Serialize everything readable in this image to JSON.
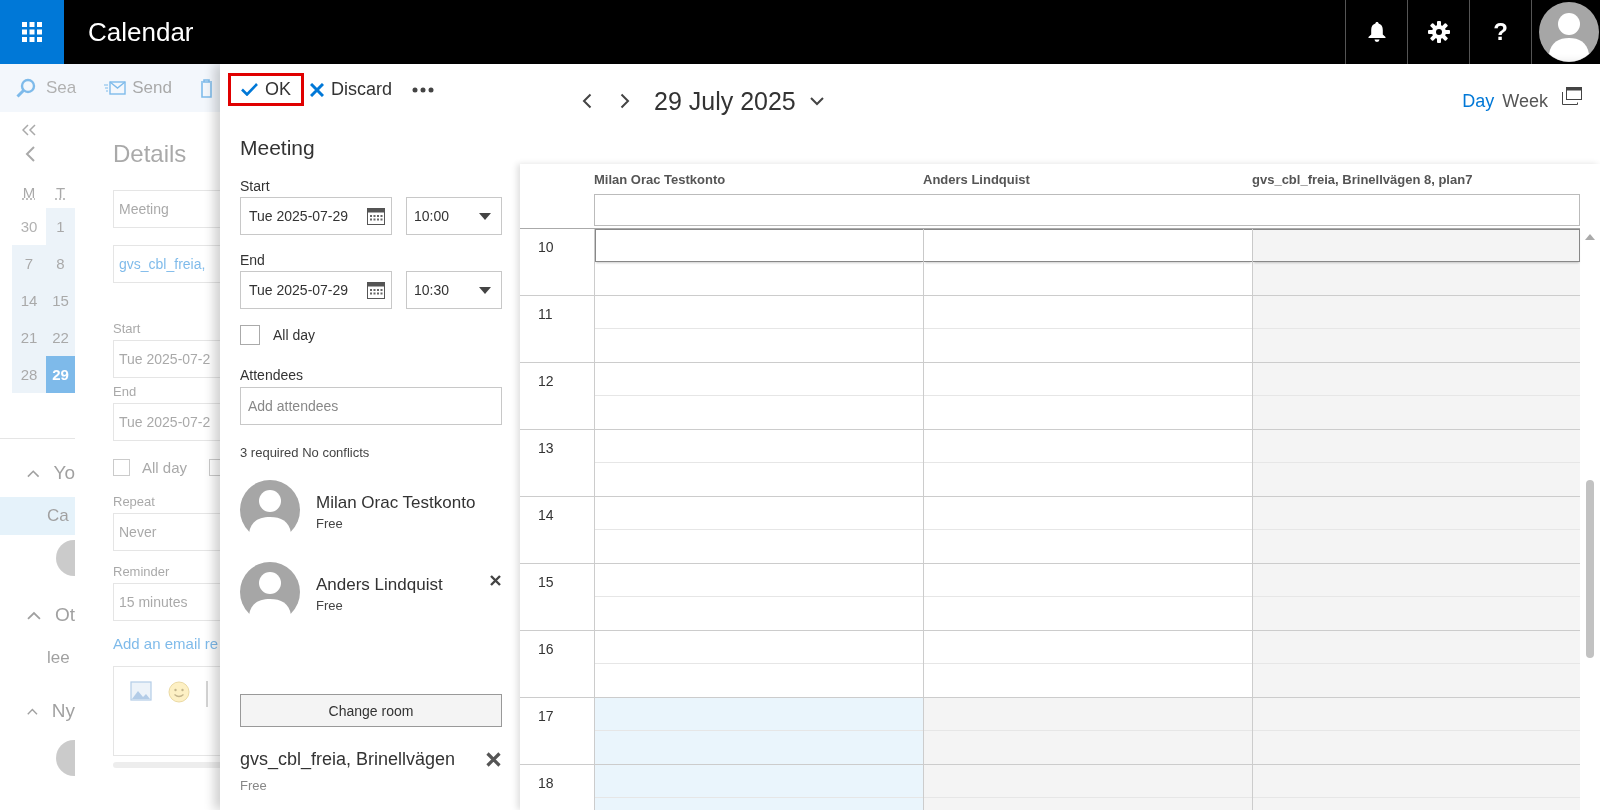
{
  "app_bar": {
    "title": "Calendar",
    "help": "?"
  },
  "background": {
    "search": "Sea",
    "send": "Send",
    "mini_calendar": {
      "weekdays": [
        "M",
        "T"
      ],
      "days": [
        {
          "label": "30",
          "selected": false,
          "outside_month": true
        },
        {
          "label": "1",
          "selected": false,
          "outside_month": false
        },
        {
          "label": "7",
          "selected": false,
          "outside_month": false
        },
        {
          "label": "8",
          "selected": false,
          "outside_month": false
        },
        {
          "label": "14",
          "selected": false,
          "outside_month": false
        },
        {
          "label": "15",
          "selected": false,
          "outside_month": false
        },
        {
          "label": "21",
          "selected": false,
          "outside_month": false
        },
        {
          "label": "22",
          "selected": false,
          "outside_month": false
        },
        {
          "label": "28",
          "selected": false,
          "outside_month": false
        },
        {
          "label": "29",
          "selected": true,
          "outside_month": false
        }
      ]
    },
    "sections": [
      {
        "title": "Yo",
        "expanded": true,
        "items": [
          {
            "kind": "text",
            "label": "Ca",
            "selected": true
          },
          {
            "kind": "person"
          }
        ]
      },
      {
        "title": "Ot",
        "expanded": true,
        "items": [
          {
            "kind": "text",
            "label": "lee",
            "selected": false
          }
        ]
      },
      {
        "title": "Ny",
        "expanded": true,
        "items": [
          {
            "kind": "person"
          }
        ]
      }
    ],
    "details": {
      "title": "Details",
      "subject": "Meeting",
      "location": "gvs_cbl_freia,",
      "start_label": "Start",
      "start": "Tue 2025-07-2",
      "end_label": "End",
      "end": "Tue 2025-07-2",
      "checkboxes": [
        {
          "label": "All day",
          "checked": false
        },
        {
          "checked": false
        }
      ],
      "repeat_label": "Repeat",
      "repeat": "Never",
      "reminder_label": "Reminder",
      "reminder": "15 minutes",
      "add_email_link": "Add an email re"
    }
  },
  "form": {
    "ok": {
      "label": "OK",
      "highlighted": true
    },
    "discard": "Discard",
    "title": "Meeting",
    "start_label": "Start",
    "start_date": "Tue 2025-07-29",
    "start_time": "10:00",
    "end_label": "End",
    "end_date": "Tue 2025-07-29",
    "end_time": "10:30",
    "all_day": {
      "label": "All day",
      "checked": false
    },
    "attendees_label": "Attendees",
    "attendees_placeholder": "Add attendees",
    "summary": "3 required No conflicts",
    "attendees": [
      {
        "name": "Milan Orac Testkonto",
        "status": "Free",
        "removable": false
      },
      {
        "name": "Anders Lindquist",
        "status": "Free",
        "removable": true
      }
    ],
    "change_room": "Change room",
    "room": {
      "name": "gvs_cbl_freia, Brinellvägen",
      "status": "Free"
    }
  },
  "schedule": {
    "date": "29 July 2025",
    "views": [
      {
        "label": "Day",
        "selected": true
      },
      {
        "label": "Week",
        "selected": false
      }
    ],
    "columns": [
      "Milan Orac Testkonto",
      "Anders Lindquist",
      "gvs_cbl_freia, Brinellvägen 8, plan7"
    ],
    "hours": [
      {
        "label": "10",
        "selected": true,
        "cells": [
          {
            "kind": "free"
          },
          {
            "kind": "free"
          },
          {
            "kind": "unavailable"
          }
        ]
      },
      {
        "label": "11",
        "selected": false,
        "cells": [
          {
            "kind": "free"
          },
          {
            "kind": "free"
          },
          {
            "kind": "unavailable"
          }
        ]
      },
      {
        "label": "12",
        "selected": false,
        "cells": [
          {
            "kind": "free"
          },
          {
            "kind": "free"
          },
          {
            "kind": "unavailable"
          }
        ]
      },
      {
        "label": "13",
        "selected": false,
        "cells": [
          {
            "kind": "free"
          },
          {
            "kind": "free"
          },
          {
            "kind": "unavailable"
          }
        ]
      },
      {
        "label": "14",
        "selected": false,
        "cells": [
          {
            "kind": "free"
          },
          {
            "kind": "free"
          },
          {
            "kind": "unavailable"
          }
        ]
      },
      {
        "label": "15",
        "selected": false,
        "cells": [
          {
            "kind": "free"
          },
          {
            "kind": "free"
          },
          {
            "kind": "unavailable"
          }
        ]
      },
      {
        "label": "16",
        "selected": false,
        "cells": [
          {
            "kind": "free"
          },
          {
            "kind": "free"
          },
          {
            "kind": "unavailable"
          }
        ]
      },
      {
        "label": "17",
        "selected": false,
        "cells": [
          {
            "kind": "after_hours"
          },
          {
            "kind": "unavailable"
          },
          {
            "kind": "unavailable"
          }
        ]
      },
      {
        "label": "18",
        "selected": false,
        "cells": [
          {
            "kind": "after_hours"
          },
          {
            "kind": "unavailable"
          },
          {
            "kind": "unavailable"
          }
        ]
      }
    ]
  }
}
